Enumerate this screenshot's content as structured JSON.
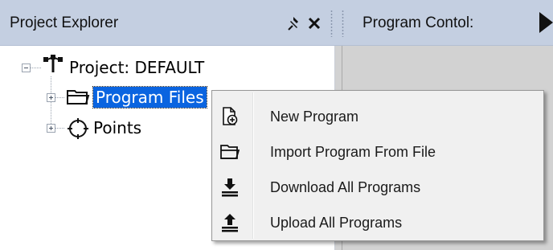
{
  "explorer": {
    "title": "Project Explorer",
    "pin_icon": "pin-icon",
    "close_icon": "close-icon",
    "tree": {
      "root": {
        "label": "Project: DEFAULT",
        "icon": "project-tree-icon",
        "expanded": true
      },
      "children": [
        {
          "label": "Program Files",
          "icon": "folder-icon",
          "selected": true,
          "expanded": false
        },
        {
          "label": "Points",
          "icon": "crosshair-icon",
          "selected": false,
          "expanded": false
        }
      ]
    }
  },
  "program_control": {
    "title": "Program Contol:",
    "play_icon": "play-icon"
  },
  "context_menu": {
    "items": [
      {
        "label": "New Program",
        "icon": "new-file-icon"
      },
      {
        "label": "Import Program From File",
        "icon": "open-folder-icon"
      },
      {
        "label": "Download All Programs",
        "icon": "download-icon"
      },
      {
        "label": "Upload All Programs",
        "icon": "upload-icon"
      }
    ]
  },
  "colors": {
    "header_bg": "#c4cfe1",
    "selection": "#0a64e0",
    "menu_bg": "#f0f0f0",
    "control_body": "#d2d2d2"
  }
}
